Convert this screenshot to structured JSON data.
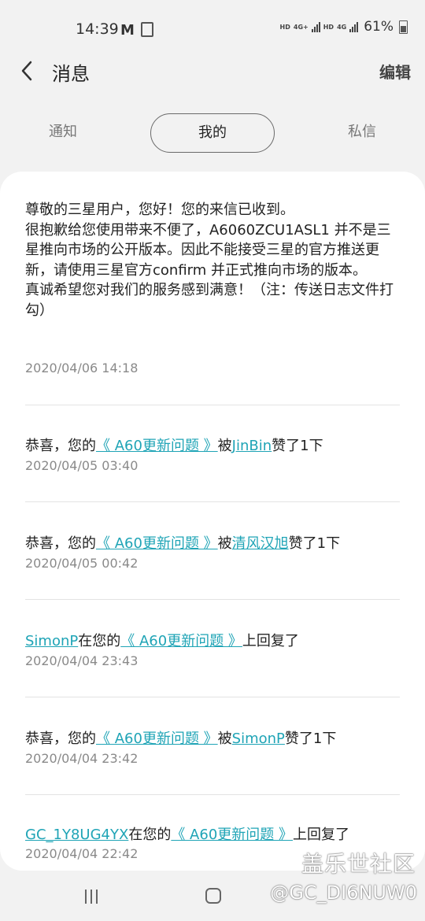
{
  "status_bar": {
    "time": "14:39",
    "gmail_icon": "M",
    "network1": "HD",
    "network2": "4G+",
    "network3": "HD",
    "network4": "4G",
    "battery": "61%"
  },
  "header": {
    "title": "消息",
    "edit_label": "编辑"
  },
  "tabs": [
    {
      "label": "通知"
    },
    {
      "label": "我的"
    },
    {
      "label": "私信"
    }
  ],
  "messages": {
    "first": {
      "line1": "尊敬的三星用户，您好！您的来信已收到。",
      "line2": "很抱歉给您使用带来不便了，A6060ZCU1ASL1 并不是三星推向市场的公开版本。因此不能接受三星的官方推送更新，请使用三星官方confirm 并正式推向市场的版本。",
      "line3": "真诚希望您对我们的服务感到满意！（注：传送日志文件打勾）",
      "time": "2020/04/06 14:18"
    },
    "items": [
      {
        "prefix": "恭喜，您的",
        "post": "《 A60更新问题 》",
        "mid": "被",
        "user": "JinBin",
        "suffix": "赞了1下",
        "time": "2020/04/05 03:40"
      },
      {
        "prefix": "恭喜，您的",
        "post": "《 A60更新问题 》",
        "mid": "被",
        "user": "清风汉旭",
        "suffix": "赞了1下",
        "time": "2020/04/05 00:42"
      },
      {
        "user": "SimonP",
        "mid": "在您的",
        "post": "《 A60更新问题 》",
        "suffix": "上回复了",
        "time": "2020/04/04 23:43"
      },
      {
        "prefix": "恭喜，您的",
        "post": "《 A60更新问题 》",
        "mid": "被",
        "user": "SimonP",
        "suffix": "赞了1下",
        "time": "2020/04/04 23:42"
      },
      {
        "user": "GC_1Y8UG4YX",
        "mid": "在您的",
        "post": "《 A60更新问题 》",
        "suffix": "上回复了",
        "time": "2020/04/04 22:42"
      }
    ]
  },
  "watermark": {
    "line1": "盖乐世社区",
    "line2": "@GC_DI6NUW0"
  },
  "colors": {
    "link": "#1fa4b6",
    "background": "#f2f2f2",
    "card": "#ffffff"
  }
}
